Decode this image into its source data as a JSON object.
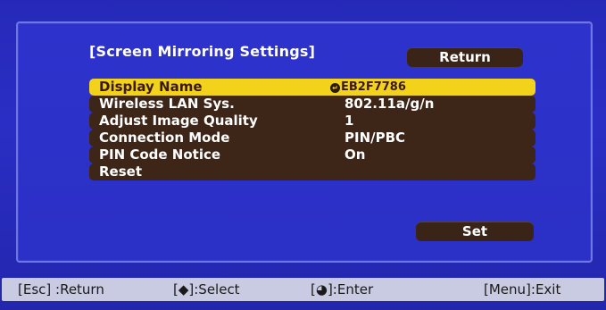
{
  "panel": {
    "title": "[Screen Mirroring Settings]",
    "return_label": "Return",
    "set_label": "Set"
  },
  "menu": {
    "items": [
      {
        "label": "Display Name",
        "value": "EB2F7786",
        "selected": true
      },
      {
        "label": "Wireless LAN Sys.",
        "value": "802.11a/g/n",
        "selected": false
      },
      {
        "label": "Adjust Image Quality",
        "value": "1",
        "selected": false
      },
      {
        "label": "Connection Mode",
        "value": "PIN/PBC",
        "selected": false
      },
      {
        "label": "PIN Code Notice",
        "value": "On",
        "selected": false
      },
      {
        "label": "Reset",
        "value": "",
        "selected": false
      }
    ]
  },
  "footer": {
    "esc_hint": "[Esc] :Return",
    "select_hint": "[◆]:Select",
    "enter_hint": "[◕]:Enter",
    "menu_hint": "[Menu]:Exit"
  },
  "colors": {
    "background": "#2a2ec4",
    "row": "#3d2518",
    "highlight": "#f2d21a",
    "footer": "#c9cbe2"
  },
  "icons": {
    "enter": "enter-icon"
  }
}
